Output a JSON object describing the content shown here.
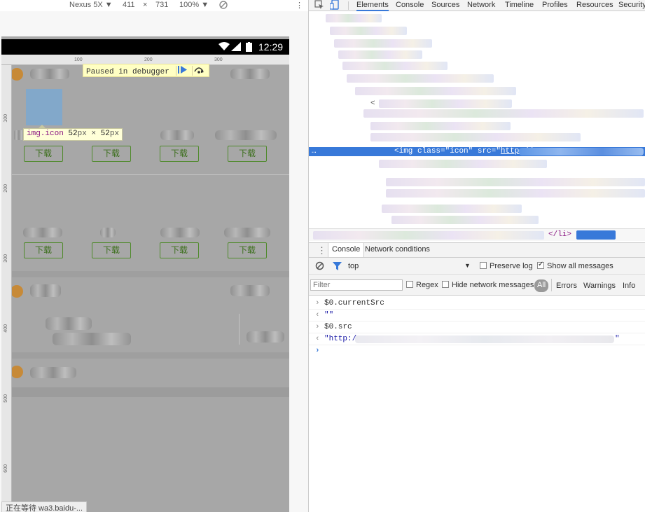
{
  "device_toolbar": {
    "device": "Nexus 5X ▼",
    "width": "411",
    "times": "×",
    "height": "731",
    "zoom": "100% ▼",
    "rotate_icon": "rotate-icon"
  },
  "phone": {
    "time": "12:29",
    "ruler_top": [
      "100",
      "200",
      "300"
    ],
    "ruler_left": [
      "100",
      "200",
      "300",
      "400",
      "500",
      "600"
    ],
    "paused_text": "Paused in debugger",
    "resume_icon": "resume-icon",
    "step_over_icon": "step-over-icon",
    "tooltip_tag": "img.icon",
    "tooltip_w": "52",
    "tooltip_h": "52",
    "tooltip_px": "px",
    "tooltip_x": "×",
    "download": "下载",
    "status_text": "正在等待 wa3.baidu-..."
  },
  "devtools": {
    "tabs": [
      "Elements",
      "Console",
      "Sources",
      "Network",
      "Timeline",
      "Profiles",
      "Resources",
      "Security"
    ],
    "inspect_icon": "inspect-icon",
    "device_mode_icon": "device-mode-icon",
    "selected_row": {
      "ellipsis": "…",
      "open": "<img ",
      "attr1": "class",
      "eq": "=",
      "val1": "\"icon\"",
      "attr2": "src",
      "val2_prefix": "\"",
      "val2": "http://"
    },
    "tree_caret": "<",
    "breadcrumb_end": "</li>",
    "drawer_tabs": [
      "Console",
      "Network conditions"
    ],
    "console_toolbar": {
      "clear_icon": "clear-icon",
      "filter_icon": "filter-icon",
      "context": "top",
      "context_arrow": "▼",
      "preserve_log": "Preserve log",
      "show_all": "Show all messages"
    },
    "filter_bar": {
      "placeholder": "Filter",
      "regex": "Regex",
      "hide_network": "Hide network messages",
      "levels": [
        "All",
        "Errors",
        "Warnings",
        "Info"
      ]
    },
    "console_lines": [
      {
        "arrow": "›",
        "text": "$0.currentSrc"
      },
      {
        "arrow": "‹",
        "text": "\"\""
      },
      {
        "arrow": "›",
        "text": "$0.src"
      },
      {
        "arrow": "‹",
        "text": "\"http:/",
        "suffix": "\""
      }
    ],
    "prompt": "›"
  },
  "colors": {
    "accent": "#3879d9",
    "download_green": "#4f8a2b",
    "paused_bg": "#ffffc3",
    "highlight": "#6fa8dc"
  }
}
